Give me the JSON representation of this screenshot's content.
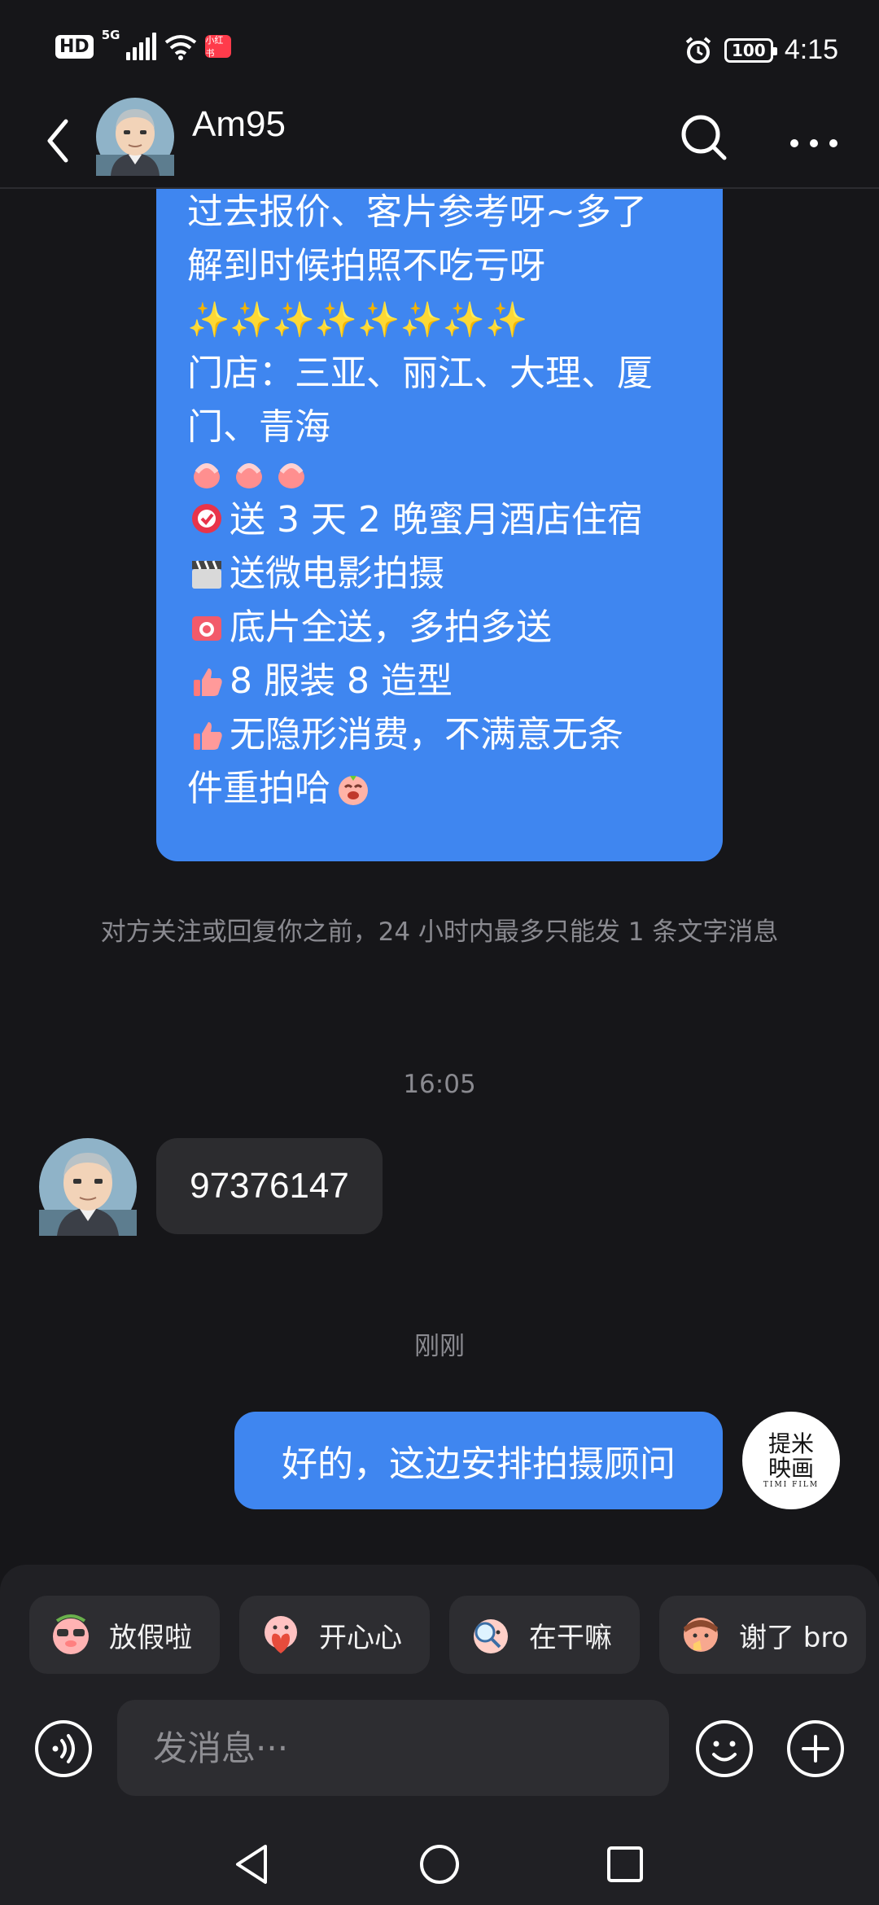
{
  "status_bar": {
    "hd_label": "HD",
    "network_label": "5G",
    "badge_label": "小红书",
    "battery": "100",
    "time": "4:15"
  },
  "header": {
    "contact_name": "Am95"
  },
  "messages": {
    "big_bubble_lines": [
      "过去报价、客片参考呀~多了",
      "解到时候拍照不吃亏呀",
      "✨✨✨✨✨✨✨✨",
      "门店：三亚、丽江、大理、厦",
      "门、青海",
      "",
      "送 3 天 2 晚蜜月酒店住宿",
      "送微电影拍摄",
      "底片全送，多拍多送",
      "8 服装 8 造型",
      "无隐形消费，不满意无条",
      "件重拍哈"
    ],
    "notice": "对方关注或回复你之前，24 小时内最多只能发 1 条文字消息",
    "time_1": "16:05",
    "peer_message": "97376147",
    "time_2": "刚刚",
    "my_message": "好的，这边安排拍摄顾问",
    "my_avatar_line1": "提米",
    "my_avatar_line2": "映画",
    "my_avatar_sub": "TIMI FILM"
  },
  "quick_replies": [
    {
      "label": "放假啦",
      "icon": "pig-sunglasses-sticker-icon"
    },
    {
      "label": "开心心",
      "icon": "pig-heart-sticker-icon"
    },
    {
      "label": "在干嘛",
      "icon": "pig-magnifier-sticker-icon"
    },
    {
      "label": "谢了 bro",
      "icon": "pig-thumbs-sticker-icon"
    }
  ],
  "composer": {
    "placeholder": "发消息···"
  },
  "colors": {
    "background": "#161619",
    "accent_bubble": "#3f86f0",
    "peer_bubble": "#2c2c2f",
    "panel": "#202024"
  }
}
